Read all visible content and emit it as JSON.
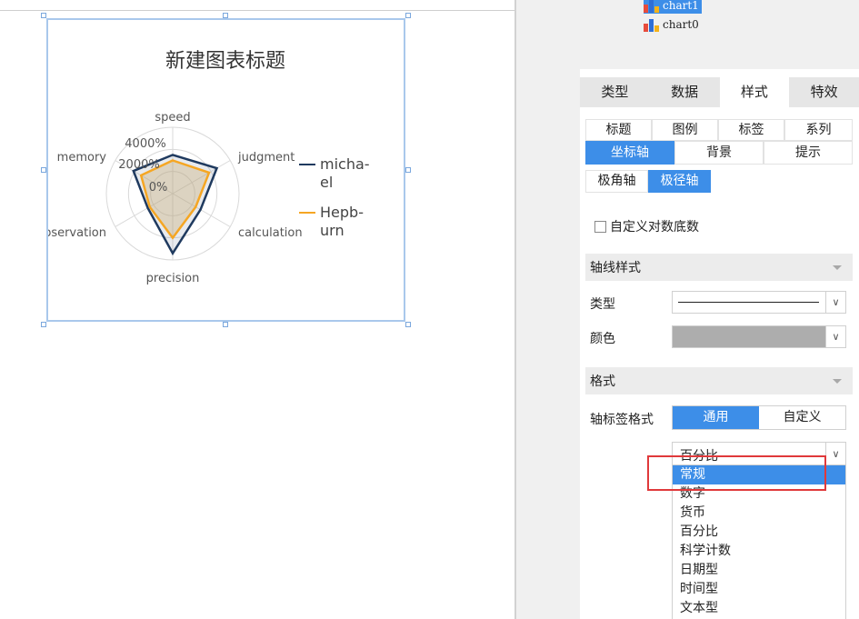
{
  "chart": {
    "title": "新建图表标题",
    "axes": [
      "speed",
      "judgment",
      "calculation",
      "precision",
      "observation",
      "memory"
    ],
    "ticks": [
      "4000%",
      "2000%",
      "0%"
    ],
    "legend": [
      {
        "line1": "micha-",
        "line2": "el",
        "color": "#1f3a5f"
      },
      {
        "line1": "Hepb-",
        "line2": "urn",
        "color": "#f5a623"
      }
    ]
  },
  "chart_data": {
    "type": "radar",
    "title": "新建图表标题",
    "categories": [
      "speed",
      "judgment",
      "calculation",
      "precision",
      "observation",
      "memory"
    ],
    "rmax": 6000,
    "ticks": [
      0,
      2000,
      4000
    ],
    "series": [
      {
        "name": "michael",
        "values": [
          3500,
          4600,
          2900,
          5400,
          2600,
          4100
        ],
        "color": "#1f3a5f"
      },
      {
        "name": "Hepburn",
        "values": [
          3000,
          3800,
          2400,
          4000,
          2400,
          3300
        ],
        "color": "#f5a623"
      }
    ]
  },
  "tree": {
    "items": [
      {
        "label": "chart1",
        "selected": true
      },
      {
        "label": "chart0",
        "selected": false
      }
    ]
  },
  "tabs": {
    "main": [
      {
        "label": "类型",
        "active": false
      },
      {
        "label": "数据",
        "active": false
      },
      {
        "label": "样式",
        "active": true
      },
      {
        "label": "特效",
        "active": false
      }
    ]
  },
  "style_tabs": {
    "row1": [
      "标题",
      "图例",
      "标签",
      "系列"
    ],
    "row2": [
      "坐标轴",
      "背景",
      "提示"
    ],
    "axis": [
      "极角轴",
      "极径轴"
    ]
  },
  "custom_log_label": "自定义对数底数",
  "sections": {
    "axis_line": "轴线样式",
    "format": "格式"
  },
  "props": {
    "type_label": "类型",
    "color_label": "颜色",
    "axis_label_format": "轴标签格式",
    "format_modes": [
      "通用",
      "自定义"
    ]
  },
  "format_select": {
    "value": "百分比"
  },
  "dropdown_options": [
    "常规",
    "数字",
    "货币",
    "百分比",
    "科学计数",
    "日期型",
    "时间型",
    "文本型"
  ],
  "colors": {
    "accent": "#3d8ee8",
    "highlight": "#e0393b"
  }
}
